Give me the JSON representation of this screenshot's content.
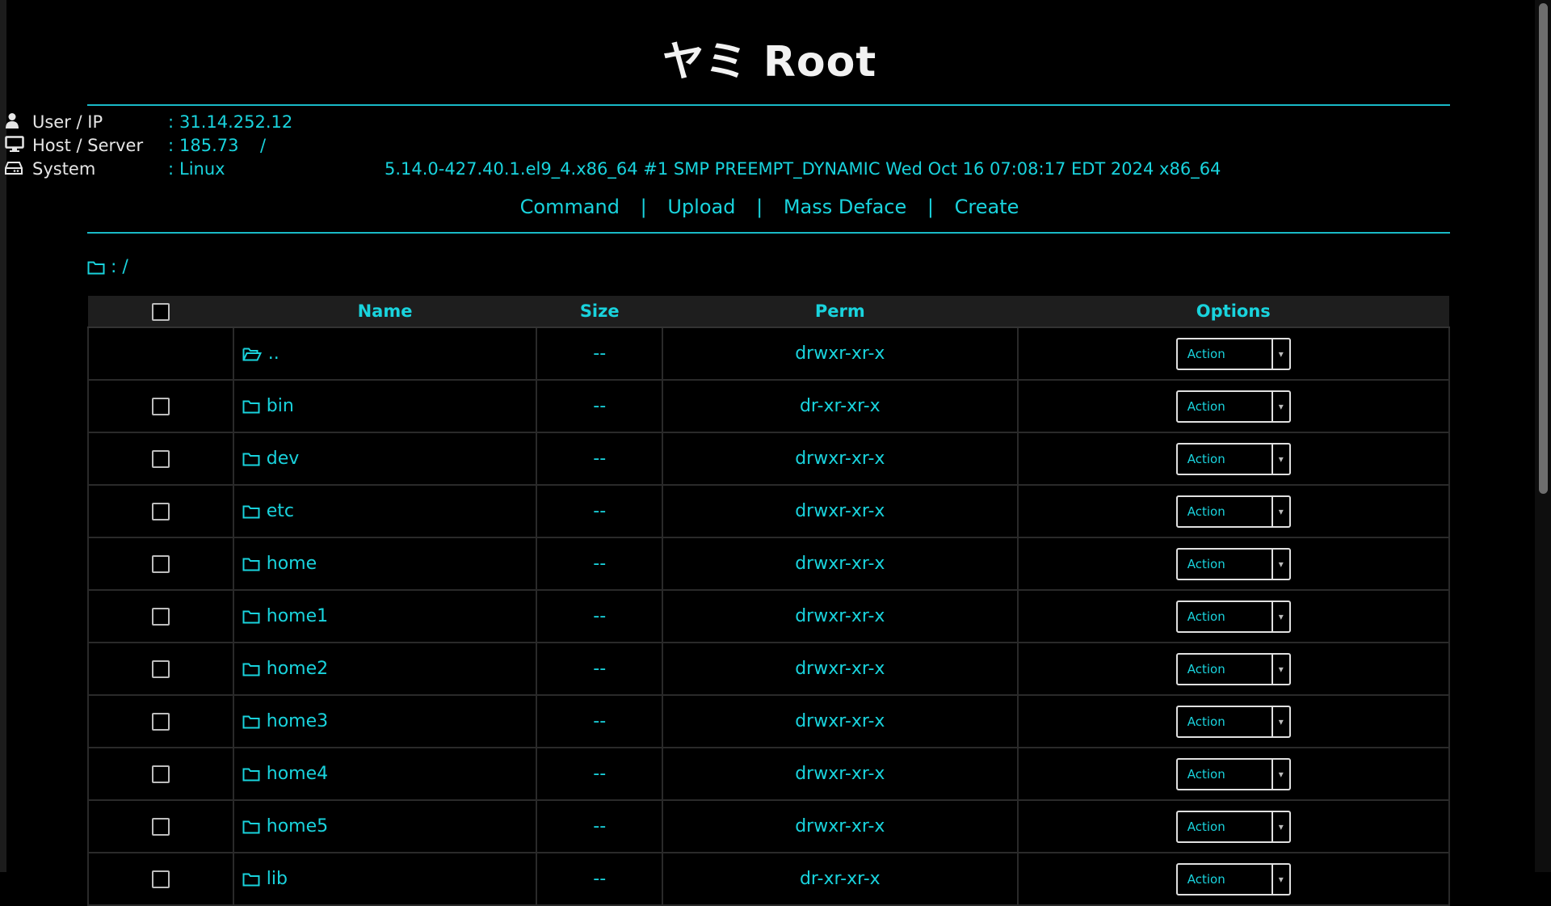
{
  "app": {
    "title": "ヤミ Root"
  },
  "info": {
    "user_label": "User / IP",
    "user_value": "31.14.252.12",
    "host_label": "Host / Server",
    "host_value": "185.73",
    "host_sep": "/",
    "system_label": "System",
    "system_value": "Linux",
    "system_kernel": "5.14.0-427.40.1.el9_4.x86_64 #1 SMP PREEMPT_DYNAMIC Wed Oct 16 07:08:17 EDT 2024 x86_64"
  },
  "nav": {
    "items": [
      "Command",
      "Upload",
      "Mass Deface",
      "Create"
    ],
    "separator": "|"
  },
  "path": {
    "colon": ":",
    "current": "/"
  },
  "table": {
    "headers": {
      "name": "Name",
      "size": "Size",
      "perm": "Perm",
      "options": "Options"
    },
    "rows": [
      {
        "name": "..",
        "size": "--",
        "perm": "drwxr-xr-x",
        "action": "Action",
        "icon": "folder-open-icon"
      },
      {
        "name": "bin",
        "size": "--",
        "perm": "dr-xr-xr-x",
        "action": "Action",
        "icon": "folder-icon"
      },
      {
        "name": "dev",
        "size": "--",
        "perm": "drwxr-xr-x",
        "action": "Action",
        "icon": "folder-icon"
      },
      {
        "name": "etc",
        "size": "--",
        "perm": "drwxr-xr-x",
        "action": "Action",
        "icon": "folder-icon"
      },
      {
        "name": "home",
        "size": "--",
        "perm": "drwxr-xr-x",
        "action": "Action",
        "icon": "folder-icon"
      },
      {
        "name": "home1",
        "size": "--",
        "perm": "drwxr-xr-x",
        "action": "Action",
        "icon": "folder-icon"
      },
      {
        "name": "home2",
        "size": "--",
        "perm": "drwxr-xr-x",
        "action": "Action",
        "icon": "folder-icon"
      },
      {
        "name": "home3",
        "size": "--",
        "perm": "drwxr-xr-x",
        "action": "Action",
        "icon": "folder-icon"
      },
      {
        "name": "home4",
        "size": "--",
        "perm": "drwxr-xr-x",
        "action": "Action",
        "icon": "folder-icon"
      },
      {
        "name": "home5",
        "size": "--",
        "perm": "drwxr-xr-x",
        "action": "Action",
        "icon": "folder-icon"
      },
      {
        "name": "lib",
        "size": "--",
        "perm": "dr-xr-xr-x",
        "action": "Action",
        "icon": "folder-icon"
      }
    ]
  },
  "colors": {
    "accent": "#19d3dd",
    "rule": "#19b9c7",
    "background": "#000000"
  }
}
